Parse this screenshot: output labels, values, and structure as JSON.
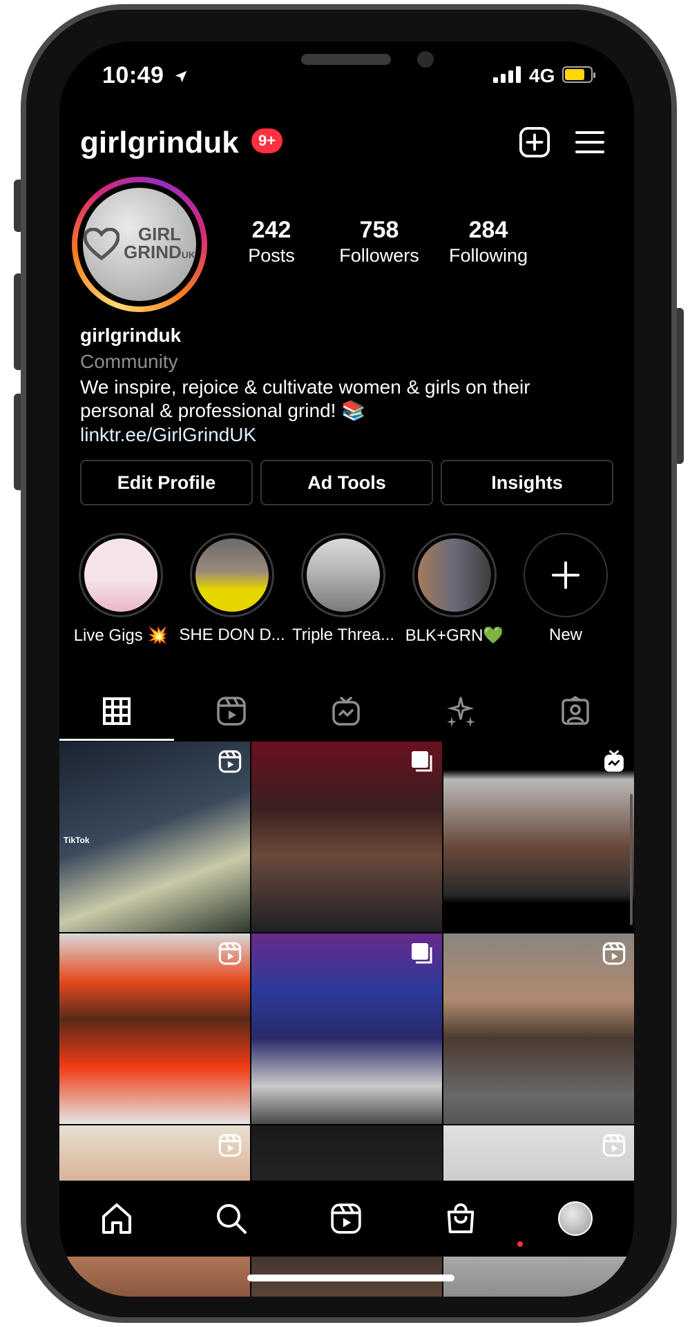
{
  "status_bar": {
    "time": "10:49",
    "network": "4G"
  },
  "header": {
    "username": "girlgrinduk",
    "notif_badge": "9+"
  },
  "avatar": {
    "logo_line1": "GIRL",
    "logo_line2": "GRIND",
    "logo_line3": "UK"
  },
  "stats": [
    {
      "value": "242",
      "label": "Posts"
    },
    {
      "value": "758",
      "label": "Followers"
    },
    {
      "value": "284",
      "label": "Following"
    }
  ],
  "bio": {
    "name": "girlgrinduk",
    "category": "Community",
    "line1": "We inspire, rejoice & cultivate women & girls on their",
    "line2": "personal & professional grind! 📚",
    "link": "linktr.ee/GirlGrindUK"
  },
  "buttons": {
    "edit": "Edit Profile",
    "ad_tools": "Ad Tools",
    "insights": "Insights"
  },
  "highlights": [
    {
      "label": "Live Gigs 💥",
      "colors": [
        "#f6e3ea",
        "#e9b8c8"
      ]
    },
    {
      "label": "SHE DON D...",
      "colors": [
        "#6b6b6b",
        "#e6d600"
      ]
    },
    {
      "label": "Triple Threa...",
      "colors": [
        "#d9d9d9",
        "#7a7a7a"
      ]
    },
    {
      "label": "BLK+GRN💚",
      "colors": [
        "#a27b5a",
        "#3d3d3d"
      ]
    },
    {
      "label": "New"
    }
  ],
  "tabs": [
    "grid-icon",
    "reels-icon",
    "igtv-icon",
    "effects-icon",
    "tagged-icon"
  ],
  "grid": [
    {
      "bg": "linear-gradient(160deg,#1a2330 0%,#3a4a5c 45%,#c9c9a8 70%,#2e3a2e 100%)",
      "type": "reel",
      "caption": "TikTok"
    },
    {
      "bg": "linear-gradient(180deg,#6a1020 0%,#3a2020 35%,#6a4a3a 60%,#202028 100%)",
      "type": "carousel"
    },
    {
      "bg": "linear-gradient(180deg,#000 0%,#000 15%,#b8b8b8 20%,#6a4a3a 55%,#2a2a2a 80%,#000 85%,#000 100%)",
      "type": "igtv"
    },
    {
      "bg": "linear-gradient(180deg,#d8d8d8 0%,#e64a1f 25%,#5a2a1a 45%,#f03c14 70%,#e5e5e5 100%)",
      "type": "reel"
    },
    {
      "bg": "linear-gradient(180deg,#6a2a8a 0%,#2a3a9a 30%,#2a2a6a 55%,#c9c9c9 80%,#4a4a4a 100%)",
      "type": "carousel"
    },
    {
      "bg": "linear-gradient(180deg,#8a8580 0%,#b08a70 35%,#4a3a30 55%,#6a6a6a 85%,#555 100%)",
      "type": "reel"
    },
    {
      "bg": "linear-gradient(180deg,#e8e0d0 0%,#d09070 50%,#7a4a30 100%)",
      "type": "reel"
    },
    {
      "bg": "linear-gradient(180deg,#1a1a1a 0%,#2a2a2a 50%,#6a4a3a 100%)",
      "type": "none"
    },
    {
      "bg": "linear-gradient(180deg,#e0e0e0 0%,#c0c0c0 50%,#808080 100%)",
      "type": "reel"
    }
  ],
  "nav": [
    "home-icon",
    "search-icon",
    "reels-icon",
    "shop-icon",
    "profile-avatar"
  ]
}
